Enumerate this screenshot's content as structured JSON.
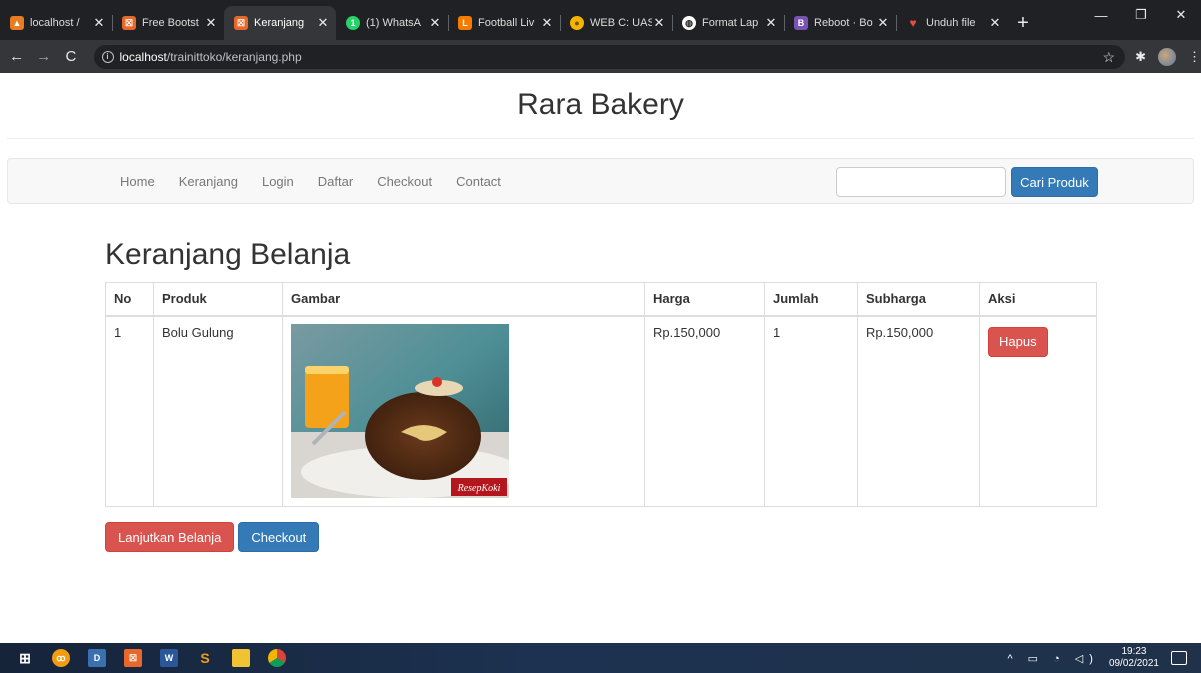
{
  "browser": {
    "tabs": [
      {
        "title": "localhost /",
        "favicon_color": "#e77d22",
        "favicon_glyph": "▲",
        "active": false
      },
      {
        "title": "Free Bootst",
        "favicon_color": "#e8682c",
        "favicon_glyph": "☒",
        "active": false
      },
      {
        "title": "Keranjang",
        "favicon_color": "#e8682c",
        "favicon_glyph": "☒",
        "active": true
      },
      {
        "title": "(1) WhatsA",
        "favicon_color": "#25d366",
        "favicon_glyph": "1",
        "active": false
      },
      {
        "title": "Football Liv",
        "favicon_color": "#f57c00",
        "favicon_glyph": "L",
        "active": false
      },
      {
        "title": "WEB C: UAS",
        "favicon_color": "#f4b400",
        "favicon_glyph": "●",
        "active": false
      },
      {
        "title": "Format Lap",
        "favicon_color": "#ffffff",
        "favicon_glyph": "◍",
        "active": false
      },
      {
        "title": "Reboot · Bo",
        "favicon_color": "#7952b3",
        "favicon_glyph": "B",
        "active": false
      },
      {
        "title": "Unduh file",
        "favicon_color": "#e74c3c",
        "favicon_glyph": "♥",
        "active": false
      }
    ],
    "close_glyph": "✕",
    "new_tab_glyph": "+",
    "url_host": "localhost",
    "url_path": "/trainittoko/keranjang.php",
    "window_controls": {
      "minimize": "—",
      "restore": "❐",
      "close": "✕"
    }
  },
  "site": {
    "title": "Rara Bakery"
  },
  "nav": {
    "links": [
      "Home",
      "Keranjang",
      "Login",
      "Daftar",
      "Checkout",
      "Contact"
    ],
    "search_value": "",
    "search_button": "Cari Produk"
  },
  "cart": {
    "heading": "Keranjang Belanja",
    "columns": [
      "No",
      "Produk",
      "Gambar",
      "Harga",
      "Jumlah",
      "Subharga",
      "Aksi"
    ],
    "rows": [
      {
        "no": "1",
        "produk": "Bolu Gulung",
        "gambar_watermark": "ResepKoki",
        "harga": "Rp.150,000",
        "jumlah": "1",
        "subharga": "Rp.150,000",
        "aksi": "Hapus"
      }
    ],
    "continue_button": "Lanjutkan Belanja",
    "checkout_button": "Checkout"
  },
  "taskbar": {
    "time": "19:23",
    "date": "09/02/2021",
    "colors": {
      "accent": "#337ab7",
      "danger": "#d9534f"
    }
  }
}
